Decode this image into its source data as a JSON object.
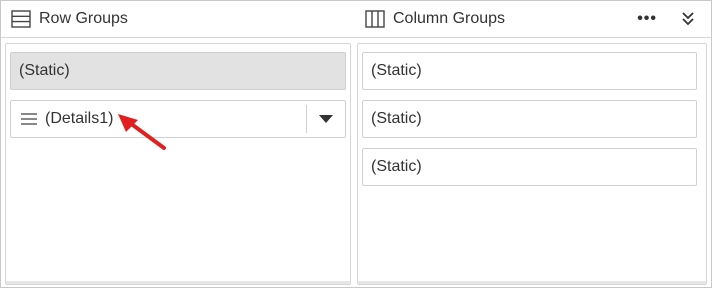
{
  "header": {
    "row_groups_label": "Row Groups",
    "column_groups_label": "Column Groups",
    "more_label": "•••",
    "icons": {
      "row_groups": "row-groups-icon",
      "column_groups": "column-groups-icon",
      "more": "more-horizontal-icon",
      "collapse": "double-chevron-down-icon"
    }
  },
  "row_groups": {
    "items": [
      {
        "label": "(Static)",
        "selected": true
      },
      {
        "label": "(Details1)",
        "icon": "drag-handle-icon",
        "has_dropdown": true
      }
    ]
  },
  "column_groups": {
    "items": [
      {
        "label": "(Static)"
      },
      {
        "label": "(Static)"
      },
      {
        "label": "(Static)"
      }
    ]
  },
  "annotation": {
    "icon": "red-arrow-icon",
    "color": "#e02020"
  }
}
